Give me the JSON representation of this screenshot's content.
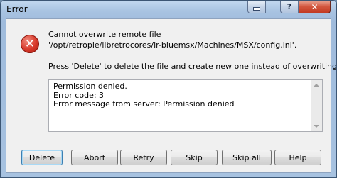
{
  "window": {
    "title": "Error"
  },
  "titlebar": {
    "help_label": "?",
    "close_label": "✕"
  },
  "message": {
    "line1": "Cannot overwrite remote file",
    "line2": "'/opt/retropie/libretrocores/lr-bluemsx/Machines/MSX/config.ini'.",
    "line3": "Press 'Delete' to delete the file and create new one instead of overwriting it."
  },
  "details": [
    "Permission denied.",
    "Error code: 3",
    "Error message from server: Permission denied"
  ],
  "buttons": {
    "delete": "Delete",
    "abort": "Abort",
    "retry": "Retry",
    "skip": "Skip",
    "skip_all": "Skip all",
    "help": "Help"
  },
  "icon": {
    "error": "error-icon"
  },
  "colors": {
    "error_red": "#d8382a",
    "default_button_border": "#3c7fb1"
  }
}
